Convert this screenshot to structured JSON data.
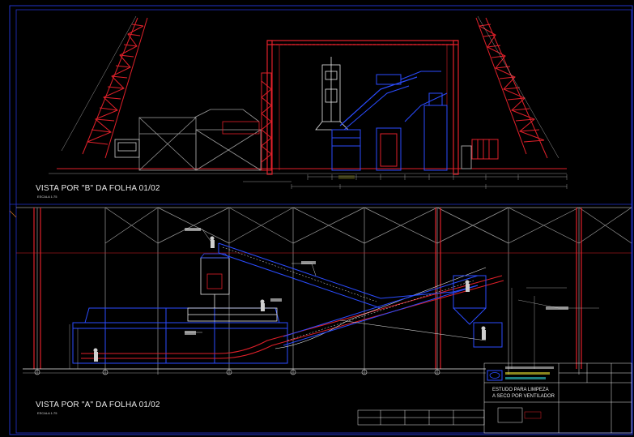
{
  "views": [
    {
      "title": "VISTA POR \"B\" DA FOLHA 01/02",
      "scale": "ESCALA 1:75"
    },
    {
      "title": "VISTA POR \"A\" DA FOLHA 01/02",
      "scale": "ESCALA 1:75"
    }
  ],
  "title_block": {
    "project_title_line1": "ESTUDO PARA LIMPEZA",
    "project_title_line2": "A SECO POR VENTILADOR"
  },
  "colors": {
    "background": "#000000",
    "structure_red": "#e0202a",
    "equipment_blue": "#2b4cff",
    "grid_gray": "#9a9a9a",
    "border_blue": "#2233cc",
    "text_white": "#e8e8e8",
    "note_yellow": "#e8e030",
    "note_cyan": "#30d0d0"
  }
}
